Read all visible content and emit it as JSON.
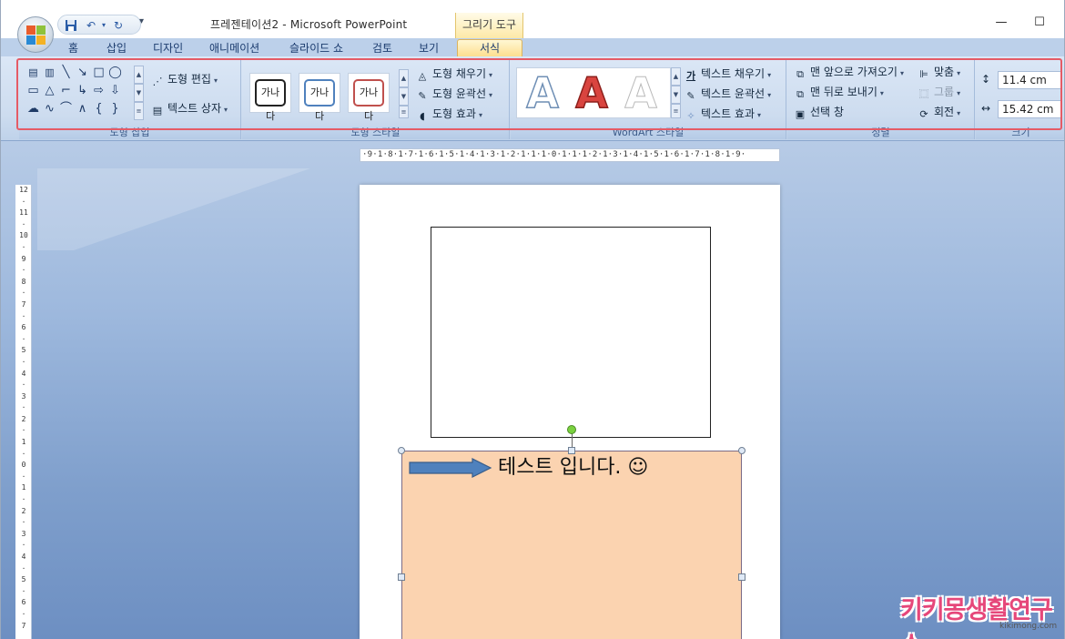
{
  "titlebar": {
    "title": "프레젠테이션2 - Microsoft PowerPoint",
    "contextual_group": "그리기 도구",
    "customize_glyph": "▾",
    "minimize_glyph": "—",
    "maximize_glyph": "☐"
  },
  "tabs": [
    {
      "label": "홈"
    },
    {
      "label": "삽입"
    },
    {
      "label": "디자인"
    },
    {
      "label": "애니메이션"
    },
    {
      "label": "슬라이드 쇼"
    },
    {
      "label": "검토"
    },
    {
      "label": "보기"
    },
    {
      "label": "서식",
      "active": true
    }
  ],
  "ribbon": {
    "insert_shapes": {
      "label": "도형 삽입",
      "edit_shape": "도형 편집",
      "text_box": "텍스트 상자"
    },
    "shape_styles": {
      "label": "도형 스타일",
      "preset_text": "가나다",
      "preset_colors": [
        "#222222",
        "#4f81bd",
        "#c0504d"
      ],
      "fill": "도형 채우기",
      "outline": "도형 윤곽선",
      "effects": "도형 효과"
    },
    "wordart_styles": {
      "label": "WordArt 스타일",
      "letter": "A",
      "text_fill": "텍스트 채우기",
      "text_outline": "텍스트 윤곽선",
      "text_effects": "텍스트 효과"
    },
    "arrange": {
      "label": "정렬",
      "bring_front": "맨 앞으로 가져오기",
      "send_back": "맨 뒤로 보내기",
      "selection_pane": "선택 창",
      "align": "맞춤",
      "group": "그룹",
      "rotate": "회전"
    },
    "size": {
      "label": "크기",
      "height": "11.4 cm",
      "width": "15.42 cm"
    }
  },
  "ruler": {
    "horizontal": "·9·1·8·1·7·1·6·1·5·1·4·1·3·1·2·1·1·1·0·1·1·1·2·1·3·1·4·1·5·1·6·1·7·1·8·1·9·",
    "vertical": [
      "12",
      "·",
      "11",
      "·",
      "10",
      "·",
      "9",
      "·",
      "8",
      "·",
      "7",
      "·",
      "6",
      "·",
      "5",
      "·",
      "4",
      "·",
      "3",
      "·",
      "2",
      "·",
      "1",
      "·",
      "0",
      "·",
      "1",
      "·",
      "2",
      "·",
      "3",
      "·",
      "4",
      "·",
      "5",
      "·",
      "6",
      "·",
      "7"
    ]
  },
  "slide": {
    "text": "테스트 입니다. ☺",
    "fill_color": "#fbd3b0"
  },
  "watermark": {
    "text": "키키몽생활연구소",
    "sub": "kikimong.com"
  },
  "colors": {
    "highlight": "#e55b66",
    "ribbon": "#cddcef",
    "tab_active": "#fddf8f"
  }
}
